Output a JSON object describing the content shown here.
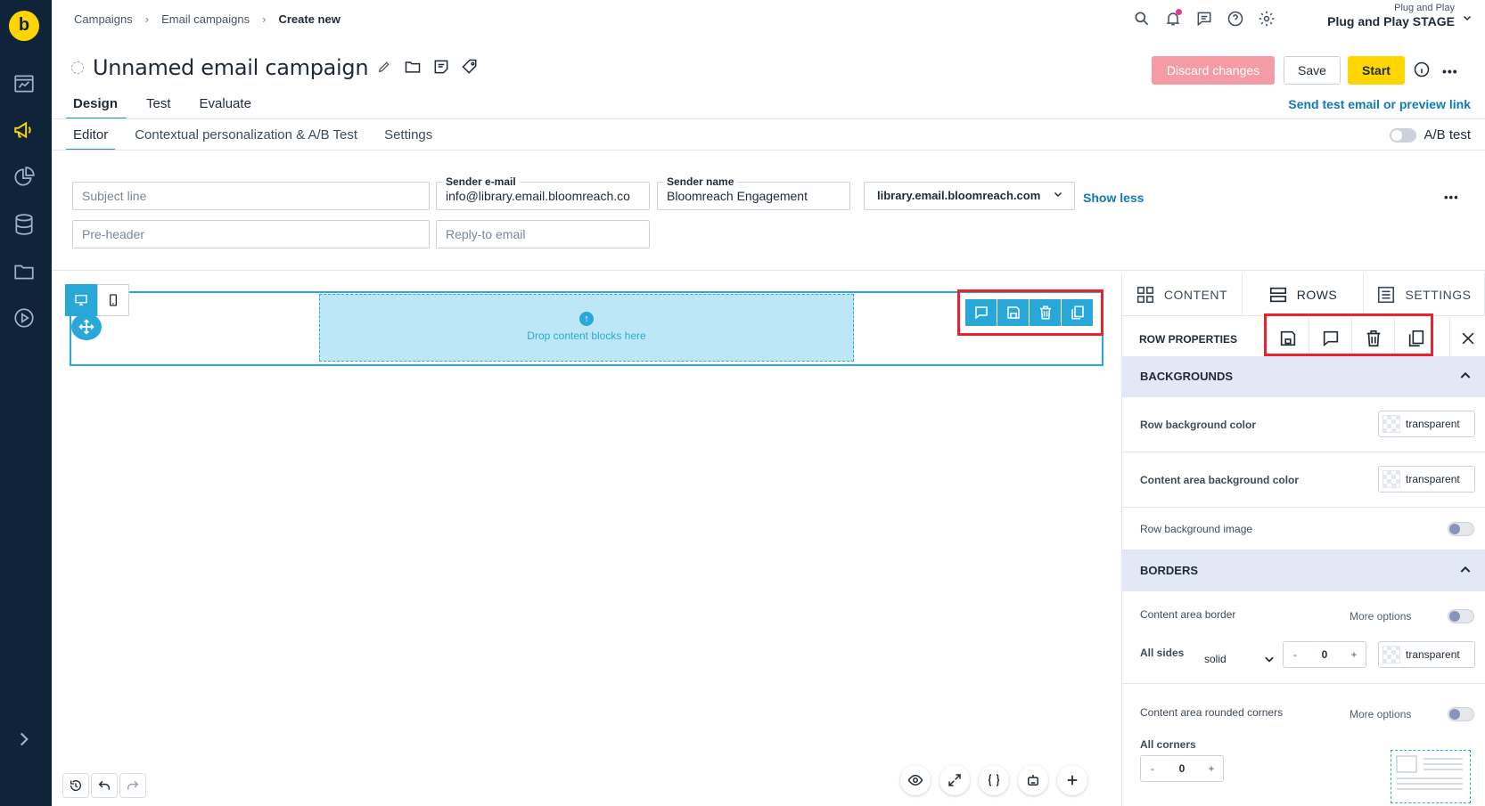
{
  "breadcrumb": {
    "items": [
      "Campaigns",
      "Email campaigns"
    ],
    "current": "Create new"
  },
  "account": {
    "org": "Plug and Play",
    "project": "Plug and Play STAGE"
  },
  "campaign": {
    "title": "Unnamed email campaign"
  },
  "header_buttons": {
    "discard": "Discard changes",
    "save": "Save",
    "start": "Start"
  },
  "tabs_main": {
    "design": "Design",
    "test": "Test",
    "evaluate": "Evaluate"
  },
  "send_test_link": "Send test email or preview link",
  "tabs_sub": {
    "editor": "Editor",
    "personalization": "Contextual personalization & A/B Test",
    "settings": "Settings"
  },
  "ab_test_label": "A/B test",
  "form": {
    "subject_placeholder": "Subject line",
    "sender_email_label": "Sender e-mail",
    "sender_email_value": "info@library.email.bloomreach.co",
    "sender_name_label": "Sender name",
    "sender_name_value": "Bloomreach Engagement",
    "domain_value": "library.email.bloomreach.com",
    "show_less": "Show less",
    "preheader_placeholder": "Pre-header",
    "reply_placeholder": "Reply-to email"
  },
  "canvas": {
    "drop_text": "Drop content blocks here"
  },
  "panel": {
    "tabs": {
      "content": "CONTENT",
      "rows": "ROWS",
      "settings": "SETTINGS"
    },
    "row_properties": "ROW PROPERTIES",
    "backgrounds": {
      "title": "BACKGROUNDS",
      "row_bg_label": "Row background color",
      "row_bg_value": "transparent",
      "content_bg_label": "Content area background color",
      "content_bg_value": "transparent",
      "row_bg_image_label": "Row background image"
    },
    "borders": {
      "title": "BORDERS",
      "content_border_label": "Content area border",
      "more_options": "More options",
      "all_sides_label": "All sides",
      "style_value": "solid",
      "width_value": "0",
      "color_value": "transparent",
      "rounded_label": "Content area rounded corners",
      "all_corners_label": "All corners",
      "corners_value": "0"
    },
    "stepper_minus": "-",
    "stepper_plus": "+"
  },
  "colors": {
    "accent": "#28a8d8",
    "brand_yellow": "#ffd500",
    "rail": "#0f2439",
    "highlight_red": "#e8232f"
  }
}
